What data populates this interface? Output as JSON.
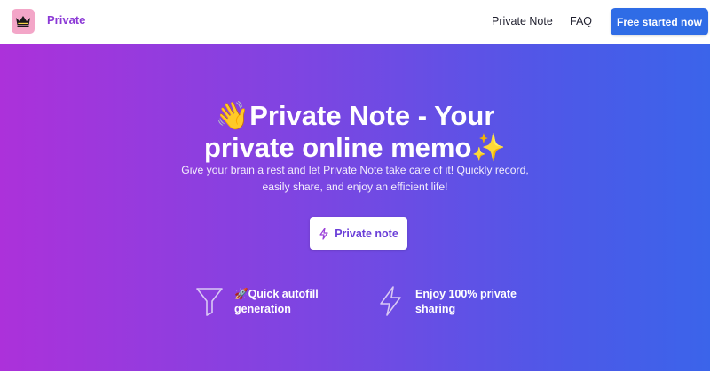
{
  "navbar": {
    "logo_icon": "crown-icon",
    "brand": "Private",
    "links": [
      "Private Note",
      "FAQ"
    ],
    "cta_label": "Free started now",
    "cta_color": "#2f6ce6"
  },
  "hero": {
    "title_line1_emoji": "👋",
    "title_line1": "Private Note - Your",
    "title_line2": "private online memo",
    "title_line2_emoji": "✨",
    "subtitle_line1": "Give your brain a rest and let Private Note take care of it! Quickly record,",
    "subtitle_line2": "easily share, and enjoy an efficient life!",
    "button_icon": "lightning-icon",
    "button_label": "Private note",
    "gradient_start": "#ac31da",
    "gradient_end": "#3b64ea"
  },
  "features": [
    {
      "icon": "funnel-icon",
      "emoji": "🚀",
      "line1": "Quick autofill",
      "line2": "generation"
    },
    {
      "icon": "lightning-icon",
      "line1": "Enjoy 100% private",
      "line2": "sharing"
    }
  ]
}
